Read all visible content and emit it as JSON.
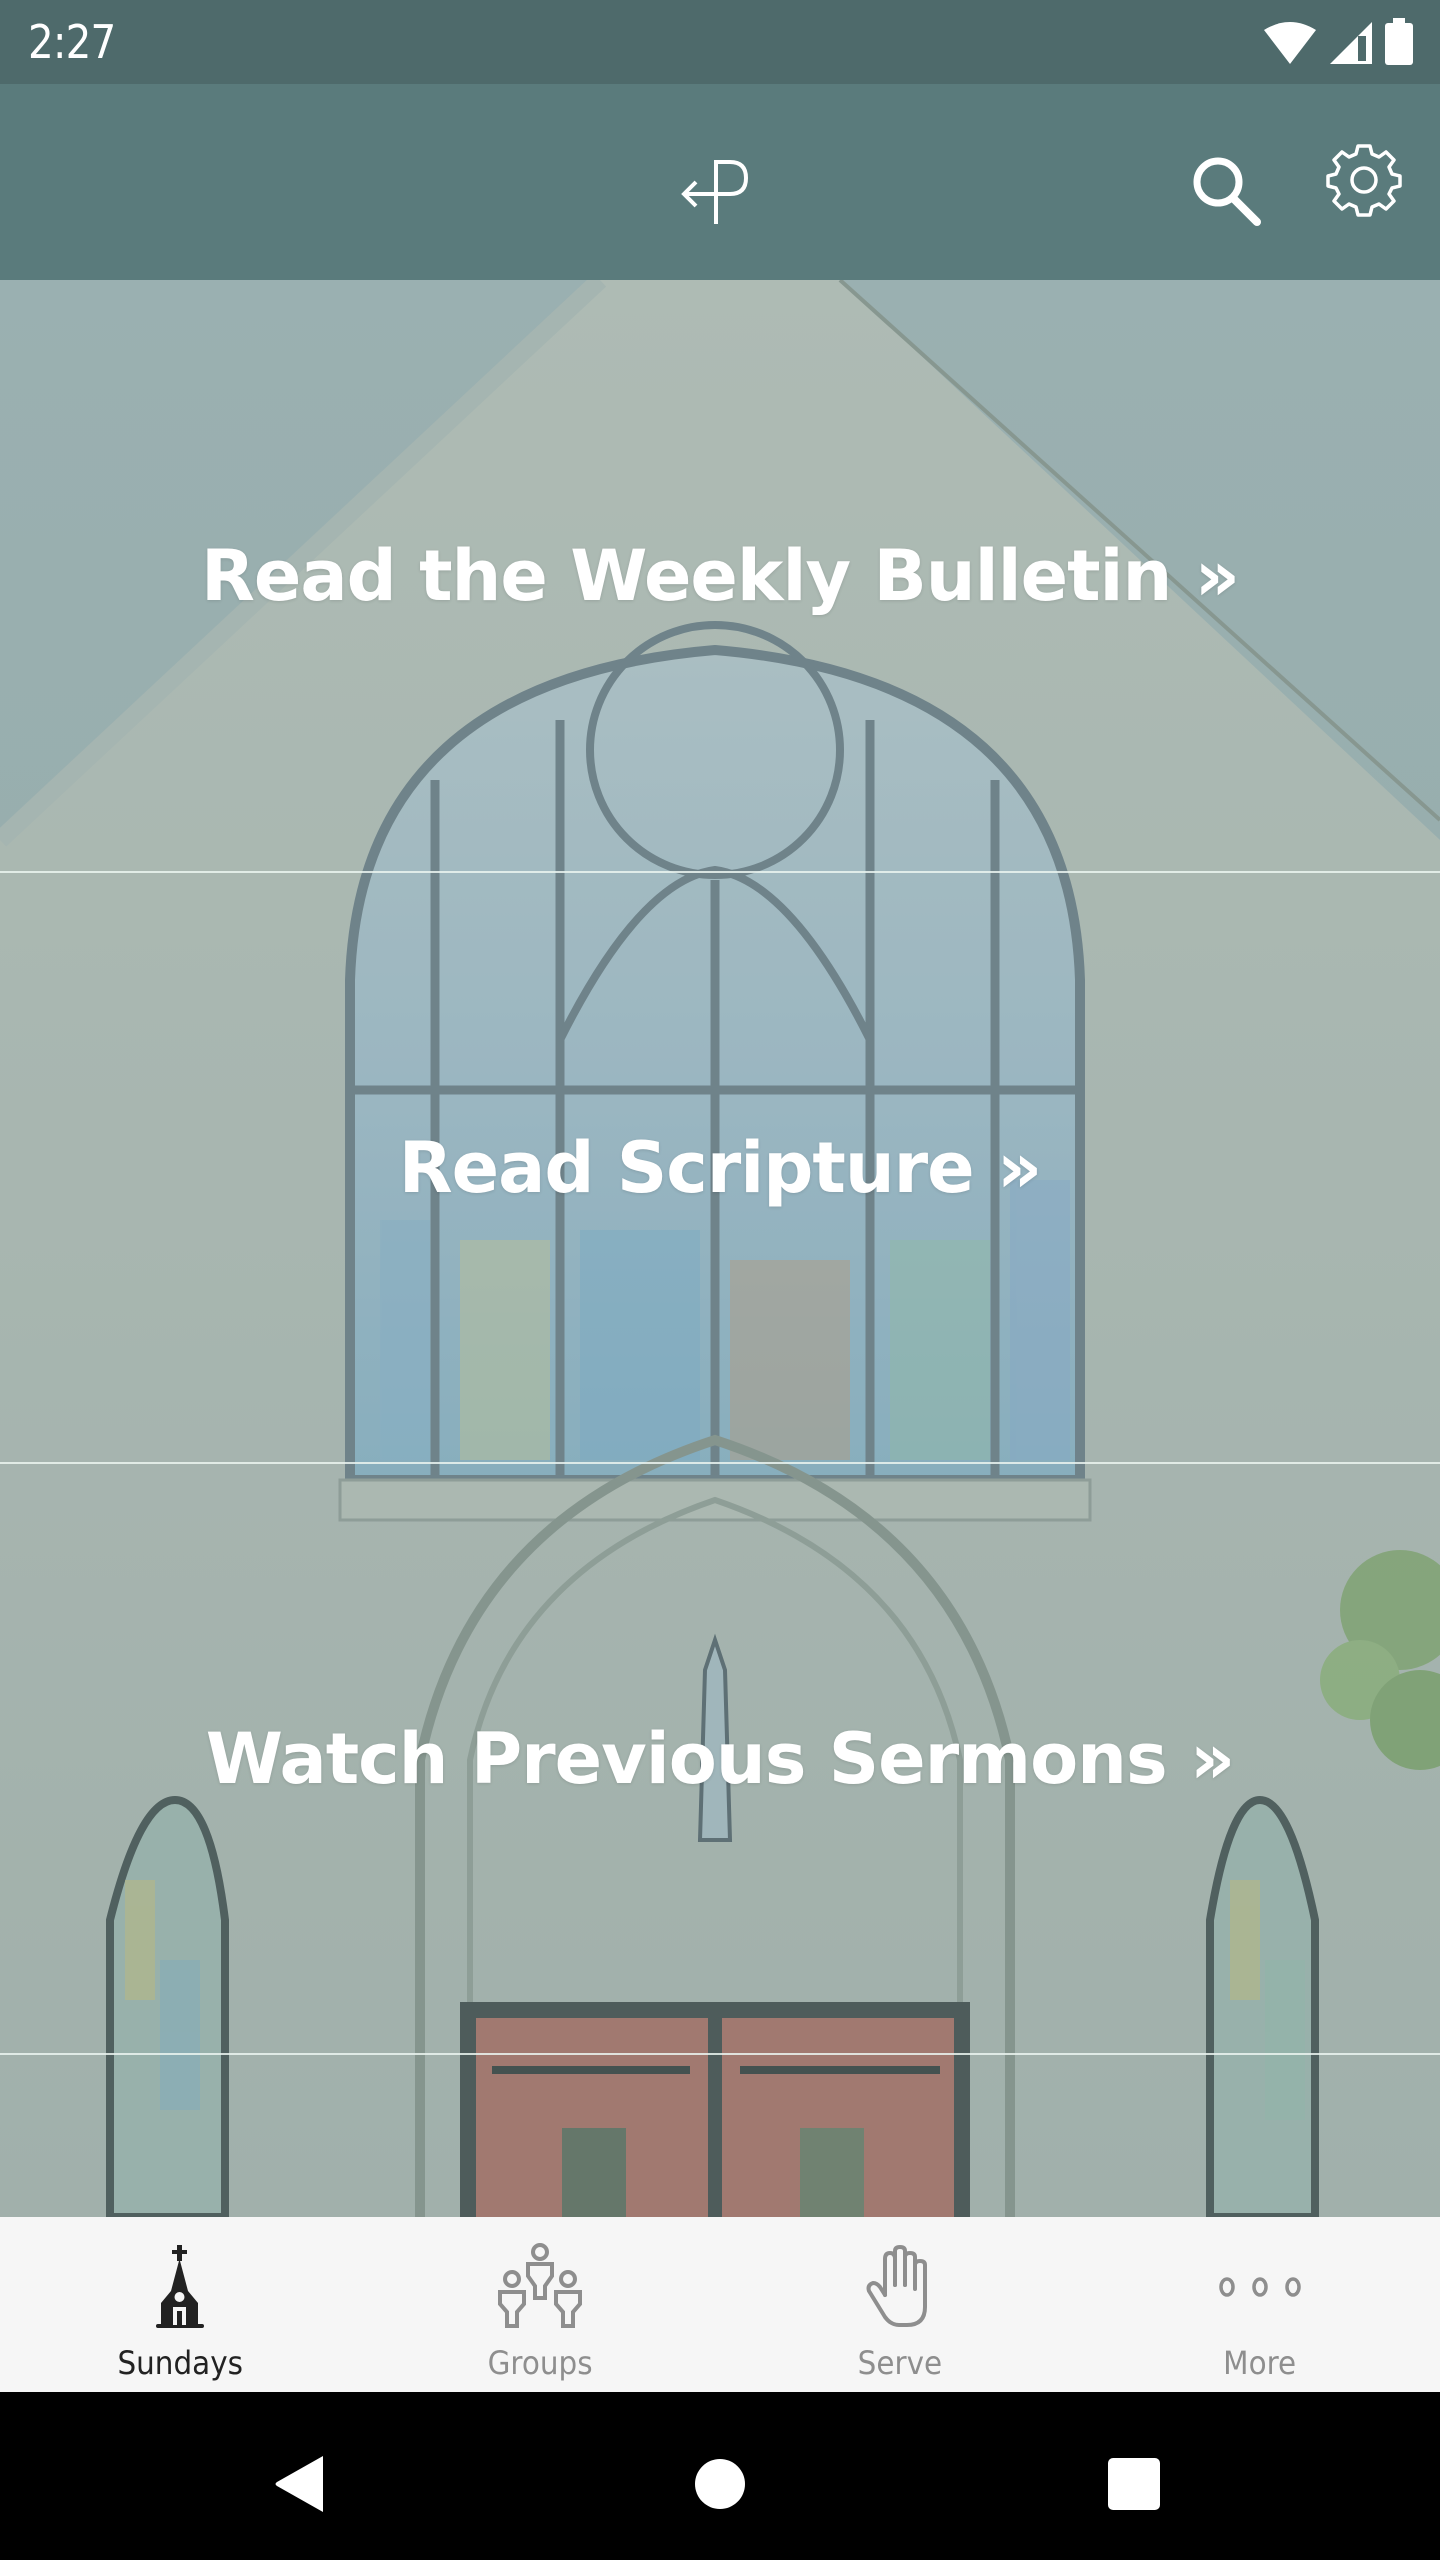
{
  "status_bar": {
    "time": "2:27",
    "icons": [
      "wifi-icon",
      "cellular-signal-icon",
      "battery-icon"
    ]
  },
  "app_bar": {
    "logo": "return-arrow-p-logo",
    "actions": [
      {
        "name": "search",
        "icon": "search-icon"
      },
      {
        "name": "settings",
        "icon": "gear-icon"
      }
    ]
  },
  "hero": {
    "links": [
      {
        "label": "Read the Weekly Bulletin »"
      },
      {
        "label": "Read Scripture »"
      },
      {
        "label": "Watch Previous Sermons »"
      }
    ]
  },
  "tabs": [
    {
      "label": "Sundays",
      "icon": "church-icon",
      "active": true
    },
    {
      "label": "Groups",
      "icon": "group-people-icon",
      "active": false
    },
    {
      "label": "Serve",
      "icon": "raised-hand-icon",
      "active": false
    },
    {
      "label": "More",
      "icon": "more-dots-icon",
      "active": false
    }
  ],
  "system_nav": {
    "buttons": [
      "back",
      "home",
      "recents"
    ]
  },
  "colors": {
    "status_bar": "#4e6a6b",
    "app_bar": "#5a7b7c",
    "tab_bar": "#f6f6f6",
    "tab_active": "#222222",
    "tab_inactive": "#8e8e8e",
    "door_red": "#b86a5c"
  }
}
